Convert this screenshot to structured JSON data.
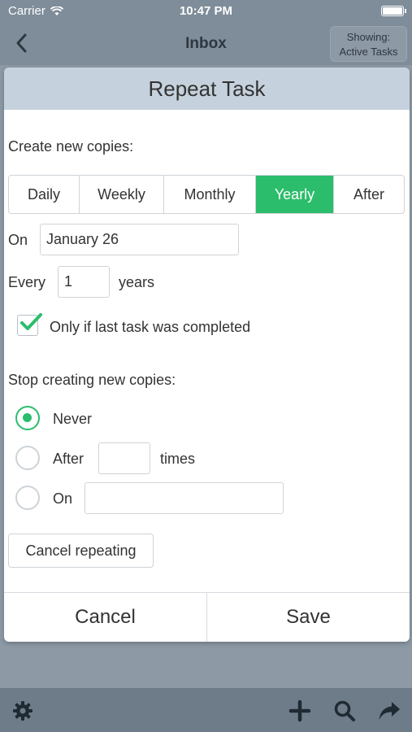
{
  "status_bar": {
    "carrier": "Carrier",
    "time": "10:47 PM"
  },
  "nav": {
    "title": "Inbox",
    "showing_line1": "Showing:",
    "showing_line2": "Active Tasks"
  },
  "dialog": {
    "title": "Repeat Task",
    "create_label": "Create new copies:",
    "frequency_options": [
      "Daily",
      "Weekly",
      "Monthly",
      "Yearly",
      "After"
    ],
    "selected_frequency": "Yearly",
    "on_label": "On",
    "on_value": "January 26",
    "every_label": "Every",
    "every_value": "1",
    "every_unit": "years",
    "only_if_completed_label": "Only if last task was completed",
    "only_if_completed_checked": true,
    "stop_label": "Stop creating new copies:",
    "stop_options": {
      "never": "Never",
      "after": "After",
      "times": "times",
      "on": "On"
    },
    "stop_selected": "Never",
    "after_value": "",
    "on_date_value": "",
    "cancel_repeating_label": "Cancel repeating",
    "cancel_label": "Cancel",
    "save_label": "Save"
  },
  "colors": {
    "accent": "#2bbd6b",
    "header_bg": "#c5d1dc",
    "overlay_bg": "#8d9aa6"
  },
  "toolbar": {
    "icons": [
      "gear-icon",
      "plus-icon",
      "search-icon",
      "share-icon"
    ]
  }
}
